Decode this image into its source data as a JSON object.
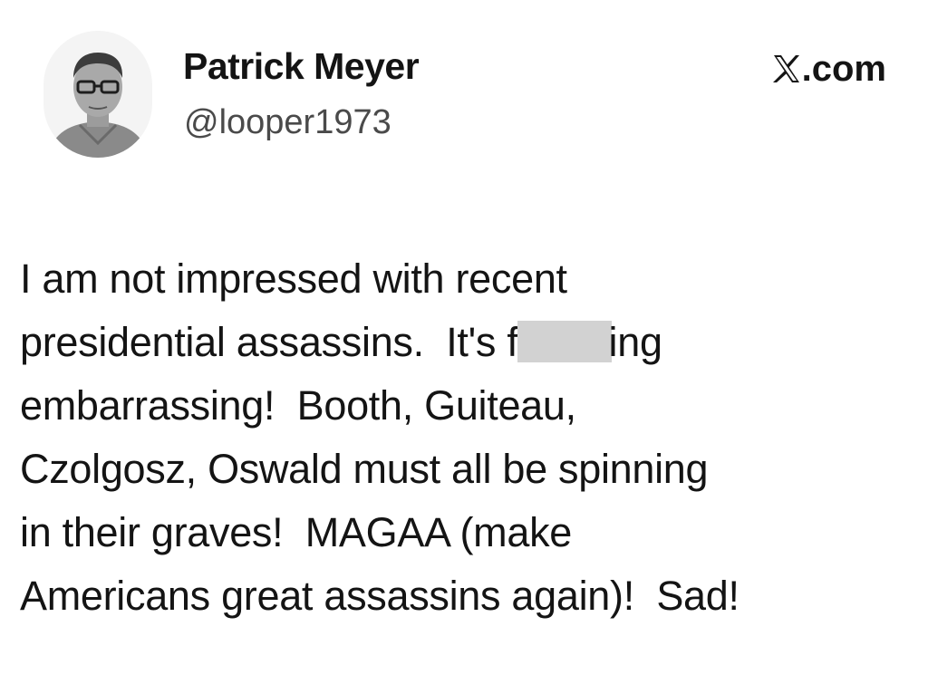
{
  "tweet": {
    "author": {
      "name": "Patrick Meyer",
      "handle": "@looper1973",
      "avatar": "profile-photo"
    },
    "site": {
      "logo": "x-logo-icon",
      "label": ".com"
    },
    "text_lines": [
      "I am not impressed with recent",
      "presidential assassins.  It's f",
      "ing",
      "embarrassing!  Booth, Guiteau,",
      "Czolgosz, Oswald must all be spinning",
      "in their graves!  MAGAA (make",
      "Americans great assassins again)!  Sad!"
    ],
    "redaction_color": "#d2d2d2"
  }
}
